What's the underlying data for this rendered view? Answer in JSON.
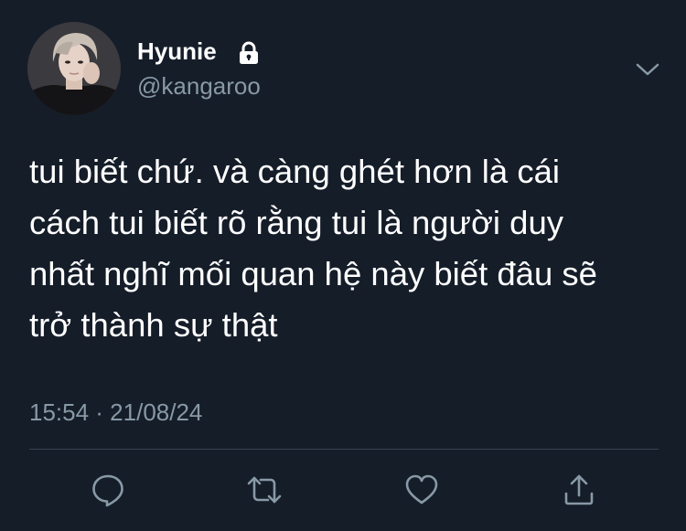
{
  "user": {
    "display_name": "Hyunie",
    "handle": "@kangaroo",
    "avatar_icon": "profile-photo",
    "locked_icon": "lock-icon"
  },
  "tweet": {
    "lines": [
      "tui biết chứ. và càng ghét hơn là cái",
      "cách tui biết rõ rằng tui là người duy",
      "nhất nghĩ mối quan hệ này biết đâu sẽ",
      "trở thành sự thật"
    ],
    "timestamp": "15:54 · 21/08/24"
  },
  "actions": [
    {
      "name": "reply",
      "icon": "reply-icon"
    },
    {
      "name": "retweet",
      "icon": "retweet-icon"
    },
    {
      "name": "like",
      "icon": "heart-icon"
    },
    {
      "name": "share",
      "icon": "share-icon"
    }
  ],
  "colors": {
    "background": "#151d29",
    "text_primary": "#ffffff",
    "text_secondary": "#8899a6",
    "divider": "#38444d"
  }
}
